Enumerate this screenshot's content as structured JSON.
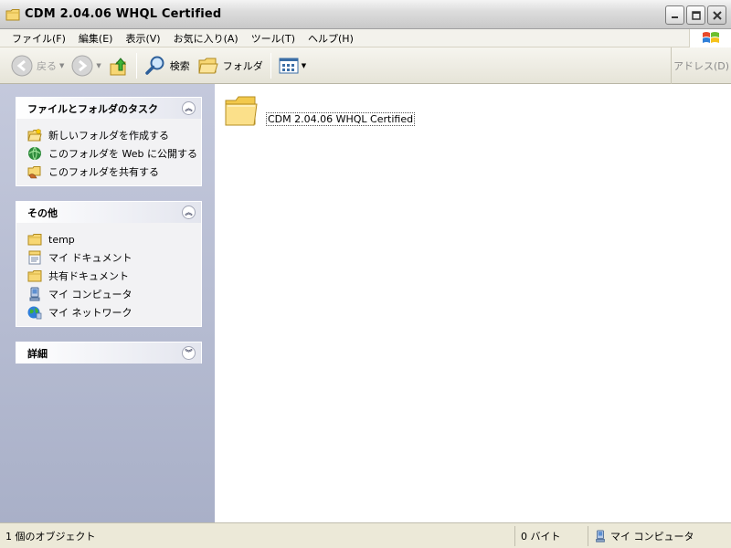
{
  "window": {
    "title": "CDM 2.04.06 WHQL Certified"
  },
  "menu": [
    "ファイル(F)",
    "編集(E)",
    "表示(V)",
    "お気に入り(A)",
    "ツール(T)",
    "ヘルプ(H)"
  ],
  "toolbar": {
    "back_label": "戻る",
    "search_label": "検索",
    "folders_label": "フォルダ",
    "address_label": "アドレス(D)"
  },
  "taskpane": {
    "tasks": {
      "title": "ファイルとフォルダのタスク",
      "items": [
        {
          "label": "新しいフォルダを作成する",
          "icon": "new-folder-icon"
        },
        {
          "label": "このフォルダを Web に公開する",
          "icon": "publish-web-icon"
        },
        {
          "label": "このフォルダを共有する",
          "icon": "share-folder-icon"
        }
      ]
    },
    "other": {
      "title": "その他",
      "items": [
        {
          "label": "temp",
          "icon": "folder-icon"
        },
        {
          "label": "マイ ドキュメント",
          "icon": "my-documents-icon"
        },
        {
          "label": "共有ドキュメント",
          "icon": "shared-documents-icon"
        },
        {
          "label": "マイ コンピュータ",
          "icon": "my-computer-icon"
        },
        {
          "label": "マイ ネットワーク",
          "icon": "my-network-icon"
        }
      ]
    },
    "details": {
      "title": "詳細"
    }
  },
  "content": {
    "items": [
      {
        "name": "CDM 2.04.06 WHQL Certified",
        "type": "folder"
      }
    ]
  },
  "statusbar": {
    "object_count": "1 個のオブジェクト",
    "size": "0 バイト",
    "location": "マイ コンピュータ"
  }
}
